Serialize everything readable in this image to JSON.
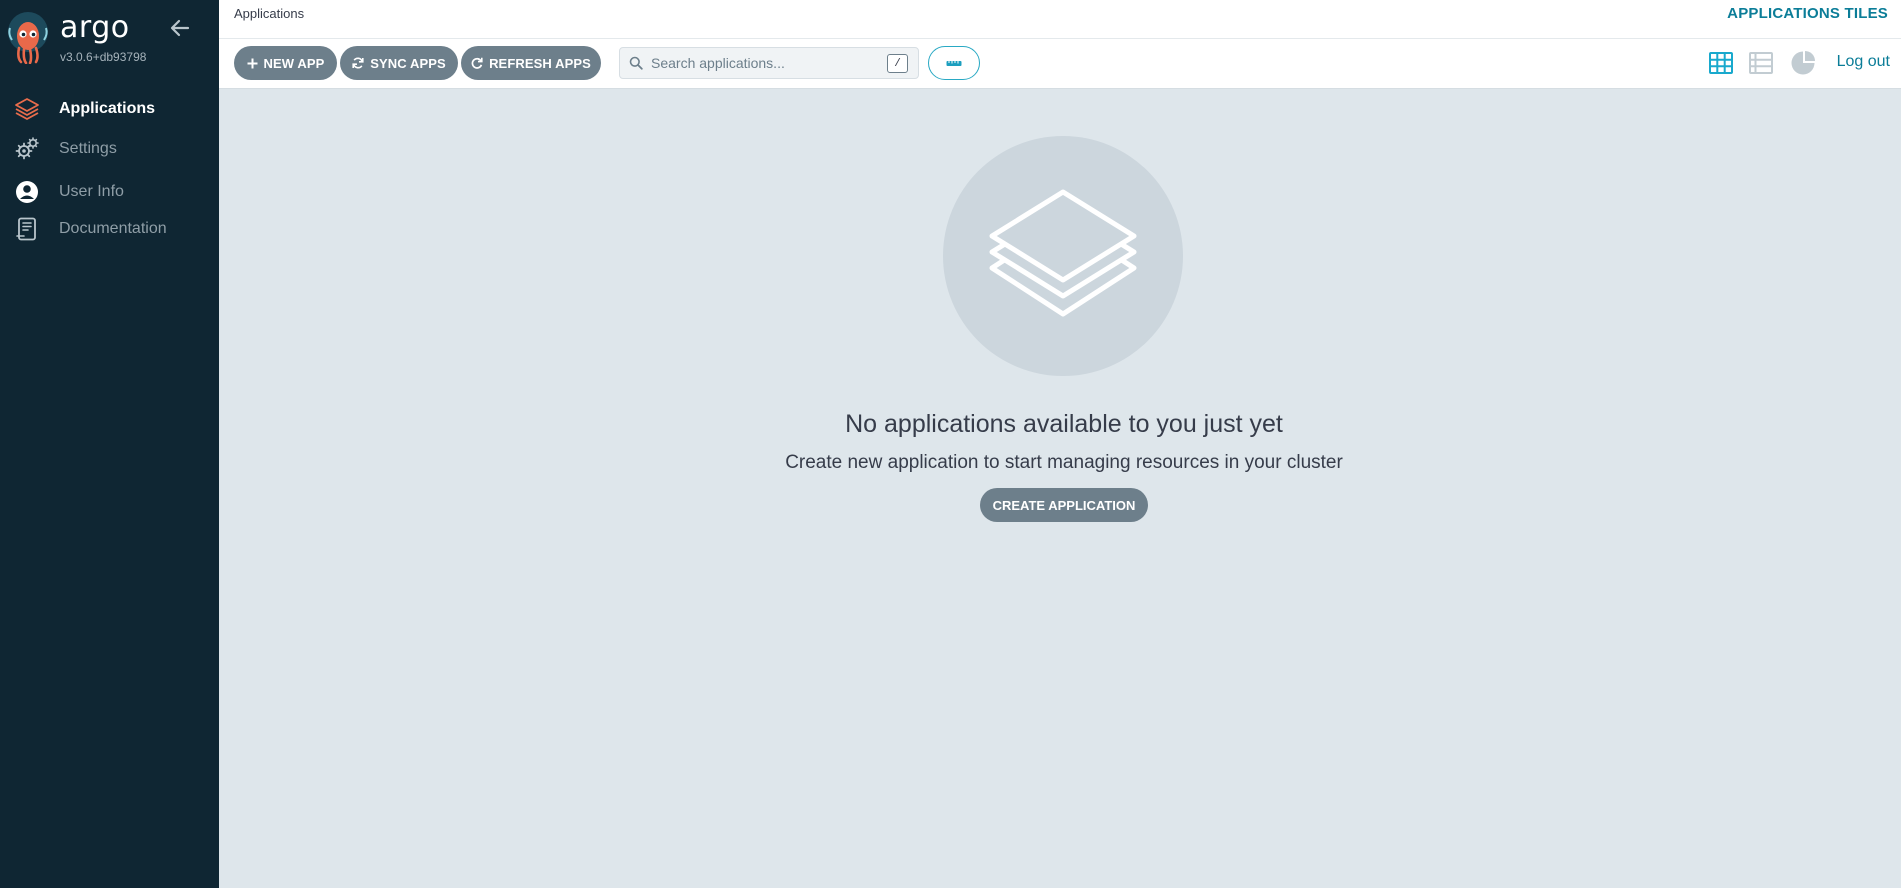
{
  "sidebar": {
    "brand": "argo",
    "version": "v3.0.6+db93798",
    "collapse_icon": "arrow-left-icon",
    "items": [
      {
        "label": "Applications",
        "icon": "layers-icon",
        "active": true
      },
      {
        "label": "Settings",
        "icon": "gears-icon",
        "active": false
      },
      {
        "label": "User Info",
        "icon": "user-circle-icon",
        "active": false
      },
      {
        "label": "Documentation",
        "icon": "book-icon",
        "active": false
      }
    ]
  },
  "header": {
    "breadcrumb": "Applications",
    "title": "APPLICATIONS TILES"
  },
  "toolbar": {
    "new_app": "NEW APP",
    "sync_apps": "SYNC APPS",
    "refresh_apps": "REFRESH APPS",
    "search_placeholder": "Search applications...",
    "search_shortcut": "/",
    "views": [
      "tiles-view-icon",
      "list-view-icon",
      "summary-pie-icon"
    ],
    "logout": "Log out"
  },
  "empty_state": {
    "title": "No applications available to you just yet",
    "subtitle": "Create new application to start managing resources in your cluster",
    "button": "CREATE APPLICATION"
  },
  "colors": {
    "sidebar_bg": "#0f2633",
    "accent": "#0b7d98",
    "button_gray": "#6d7f8b",
    "main_bg": "#dee6eb",
    "active_icon": "#e96d4c"
  }
}
